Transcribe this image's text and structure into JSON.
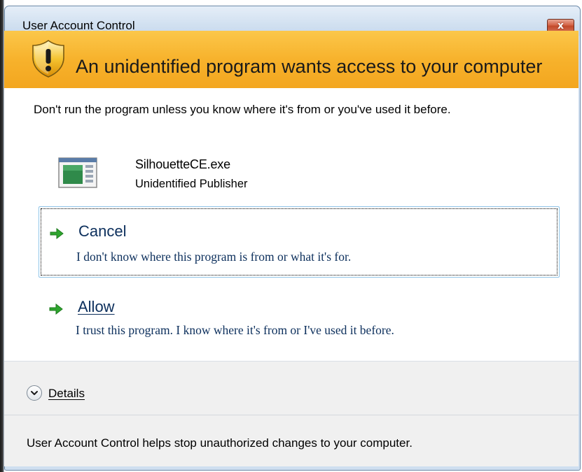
{
  "window": {
    "title": "User Account Control",
    "close_label": "x"
  },
  "banner": {
    "heading": "An unidentified program wants access to your computer",
    "icon": "shield-warning-icon"
  },
  "body": {
    "warning": "Don't run the program unless you know where it's from or you've used it before.",
    "program_name": "SilhouetteCE.exe",
    "publisher": "Unidentified Publisher"
  },
  "options": {
    "cancel": {
      "title": "Cancel",
      "description": "I don't know where this program is from or what it's for."
    },
    "allow": {
      "title": "Allow",
      "description": "I trust this program. I know where it's from or I've used it before."
    }
  },
  "details": {
    "label": "Details"
  },
  "footer": {
    "text": "User Account Control helps stop unauthorized changes to your computer."
  },
  "colors": {
    "banner": "#f7b22c",
    "option_text": "#0c2f5c",
    "arrow": "#2ea52e",
    "close_button": "#c24a2b"
  }
}
